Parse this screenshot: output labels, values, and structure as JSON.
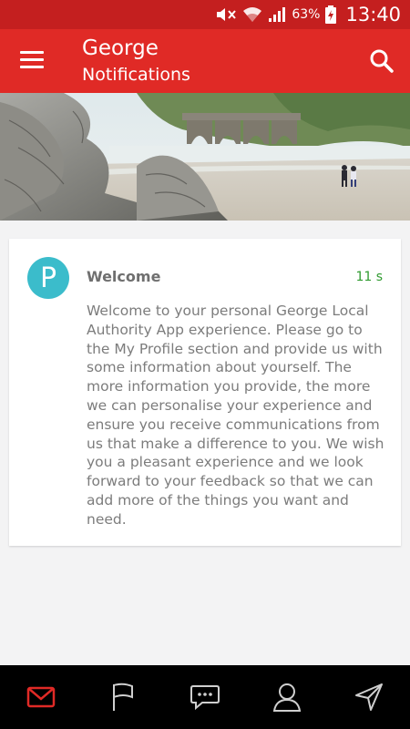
{
  "status_bar": {
    "battery_percent": "63%",
    "time": "13:40",
    "icons": [
      "mute-icon",
      "wifi-icon",
      "signal-icon",
      "battery-charging-icon"
    ]
  },
  "app_bar": {
    "title": "George",
    "subtitle": "Notifications",
    "menu_icon": "hamburger-menu-icon",
    "search_icon": "search-icon",
    "color": "#e02a26"
  },
  "notification": {
    "avatar_letter": "P",
    "avatar_color": "#3bbccb",
    "title": "Welcome",
    "time": "11 s",
    "time_color": "#2f9a2f",
    "body": "Welcome to your personal George Local Authority App experience. Please go to the My Profile section and provide us with some information about yourself. The more information you provide, the more we can personalise your experience and ensure you receive communications from us that make a difference to you. We wish you a pleasant experience and we look forward to your feedback so that we can add more of the things you want and need."
  },
  "bottom_nav": {
    "items": [
      {
        "icon": "mail-icon",
        "active": true,
        "color": "#e02a26"
      },
      {
        "icon": "flag-icon",
        "active": false
      },
      {
        "icon": "chat-icon",
        "active": false
      },
      {
        "icon": "profile-icon",
        "active": false
      },
      {
        "icon": "navigation-icon",
        "active": false
      }
    ]
  }
}
